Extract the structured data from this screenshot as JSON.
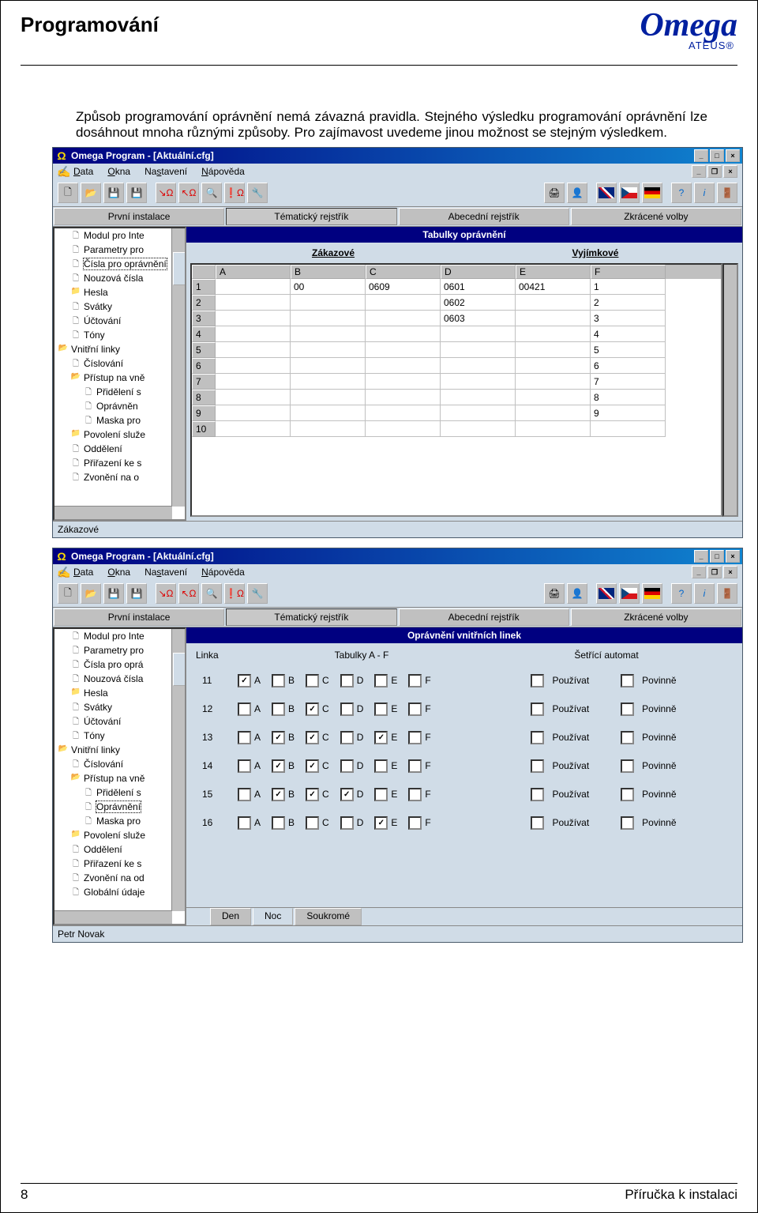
{
  "doc": {
    "title": "Programování",
    "logo_main": "Omega",
    "logo_sub": "ATEUS®",
    "para": "Způsob programování oprávnění nemá závazná pravidla. Stejného výsledku programování oprávnění lze dosáhnout mnoha různými způsoby. Pro zajímavost uvedeme jinou možnost se stejným výsledkem.",
    "page_num": "8",
    "foot_label": "Příručka k instalaci"
  },
  "app": {
    "title": "Omega Program - [Aktuální.cfg]",
    "menu": [
      "Data",
      "Okna",
      "Nastavení",
      "Nápověda"
    ],
    "tabs": [
      "První instalace",
      "Tématický rejstřík",
      "Abecední rejstřík",
      "Zkrácené volby"
    ]
  },
  "shot1": {
    "tree": [
      {
        "ind": 1,
        "icon": "doc",
        "label": "Modul pro Inte"
      },
      {
        "ind": 1,
        "icon": "doc",
        "label": "Parametry pro"
      },
      {
        "ind": 1,
        "icon": "doc",
        "label": "Čísla pro oprávnění",
        "sel": true
      },
      {
        "ind": 1,
        "icon": "doc",
        "label": "Nouzová čísla"
      },
      {
        "ind": 1,
        "icon": "fold",
        "label": "Hesla"
      },
      {
        "ind": 1,
        "icon": "doc",
        "label": "Svátky"
      },
      {
        "ind": 1,
        "icon": "doc",
        "label": "Účtování"
      },
      {
        "ind": 1,
        "icon": "doc",
        "label": "Tóny"
      },
      {
        "ind": 0,
        "icon": "fopen",
        "label": "Vnitřní linky"
      },
      {
        "ind": 1,
        "icon": "doc",
        "label": "Číslování"
      },
      {
        "ind": 1,
        "icon": "fopen",
        "label": "Přístup na vně"
      },
      {
        "ind": 2,
        "icon": "doc",
        "label": "Přidělení s"
      },
      {
        "ind": 2,
        "icon": "doc",
        "label": "Oprávněn"
      },
      {
        "ind": 2,
        "icon": "doc",
        "label": "Maska pro"
      },
      {
        "ind": 1,
        "icon": "fold",
        "label": "Povolení služe"
      },
      {
        "ind": 1,
        "icon": "doc",
        "label": "Oddělení"
      },
      {
        "ind": 1,
        "icon": "doc",
        "label": "Přiřazení ke s"
      },
      {
        "ind": 1,
        "icon": "doc",
        "label": "Zvonění na o"
      }
    ],
    "pane_title": "Tabulky oprávnění",
    "sub1": "Zákazové",
    "sub2": "Vyjímkové",
    "columns": [
      "A",
      "B",
      "C",
      "D",
      "E",
      "F"
    ],
    "rows": [
      {
        "n": "1",
        "c": [
          "",
          "00",
          "0609",
          "0601",
          "00421",
          "1"
        ]
      },
      {
        "n": "2",
        "c": [
          "",
          "",
          "",
          "0602",
          "",
          "2"
        ]
      },
      {
        "n": "3",
        "c": [
          "",
          "",
          "",
          "0603",
          "",
          "3"
        ]
      },
      {
        "n": "4",
        "c": [
          "",
          "",
          "",
          "",
          "",
          "4"
        ]
      },
      {
        "n": "5",
        "c": [
          "",
          "",
          "",
          "",
          "",
          "5"
        ]
      },
      {
        "n": "6",
        "c": [
          "",
          "",
          "",
          "",
          "",
          "6"
        ]
      },
      {
        "n": "7",
        "c": [
          "",
          "",
          "",
          "",
          "",
          "7"
        ]
      },
      {
        "n": "8",
        "c": [
          "",
          "",
          "",
          "",
          "",
          "8"
        ]
      },
      {
        "n": "9",
        "c": [
          "",
          "",
          "",
          "",
          "",
          "9"
        ]
      },
      {
        "n": "10",
        "c": [
          "",
          "",
          "",
          "",
          "",
          ""
        ]
      }
    ],
    "status": "Zákazové"
  },
  "shot2": {
    "tree": [
      {
        "ind": 1,
        "icon": "doc",
        "label": "Modul pro Inte"
      },
      {
        "ind": 1,
        "icon": "doc",
        "label": "Parametry pro"
      },
      {
        "ind": 1,
        "icon": "doc",
        "label": "Čísla pro oprá"
      },
      {
        "ind": 1,
        "icon": "doc",
        "label": "Nouzová čísla"
      },
      {
        "ind": 1,
        "icon": "fold",
        "label": "Hesla"
      },
      {
        "ind": 1,
        "icon": "doc",
        "label": "Svátky"
      },
      {
        "ind": 1,
        "icon": "doc",
        "label": "Účtování"
      },
      {
        "ind": 1,
        "icon": "doc",
        "label": "Tóny"
      },
      {
        "ind": 0,
        "icon": "fopen",
        "label": "Vnitřní linky"
      },
      {
        "ind": 1,
        "icon": "doc",
        "label": "Číslování"
      },
      {
        "ind": 1,
        "icon": "fopen",
        "label": "Přístup na vně"
      },
      {
        "ind": 2,
        "icon": "doc",
        "label": "Přidělení s"
      },
      {
        "ind": 2,
        "icon": "doc",
        "label": "Oprávnění",
        "sel": true
      },
      {
        "ind": 2,
        "icon": "doc",
        "label": "Maska pro"
      },
      {
        "ind": 1,
        "icon": "fold",
        "label": "Povolení služe"
      },
      {
        "ind": 1,
        "icon": "doc",
        "label": "Oddělení"
      },
      {
        "ind": 1,
        "icon": "doc",
        "label": "Přiřazení ke s"
      },
      {
        "ind": 1,
        "icon": "doc",
        "label": "Zvonění na od"
      },
      {
        "ind": 1,
        "icon": "doc",
        "label": "Globální údaje"
      }
    ],
    "pane_title": "Oprávnění vnitřních linek",
    "hdr_linka": "Linka",
    "hdr_tabulky": "Tabulky A - F",
    "hdr_automat": "Šetřící automat",
    "letters": [
      "A",
      "B",
      "C",
      "D",
      "E",
      "F"
    ],
    "lbl_pouzivat": "Používat",
    "lbl_povinne": "Povinně",
    "rows": [
      {
        "linka": "11",
        "chk": [
          true,
          false,
          false,
          false,
          false,
          false
        ]
      },
      {
        "linka": "12",
        "chk": [
          false,
          false,
          true,
          false,
          false,
          false
        ]
      },
      {
        "linka": "13",
        "chk": [
          false,
          true,
          true,
          false,
          true,
          false
        ]
      },
      {
        "linka": "14",
        "chk": [
          false,
          true,
          true,
          false,
          false,
          false
        ]
      },
      {
        "linka": "15",
        "chk": [
          false,
          true,
          true,
          true,
          false,
          false
        ]
      },
      {
        "linka": "16",
        "chk": [
          false,
          false,
          false,
          false,
          true,
          false
        ]
      }
    ],
    "foot_tabs": [
      "Den",
      "Noc",
      "Soukromé"
    ],
    "status": "Petr Novak"
  }
}
